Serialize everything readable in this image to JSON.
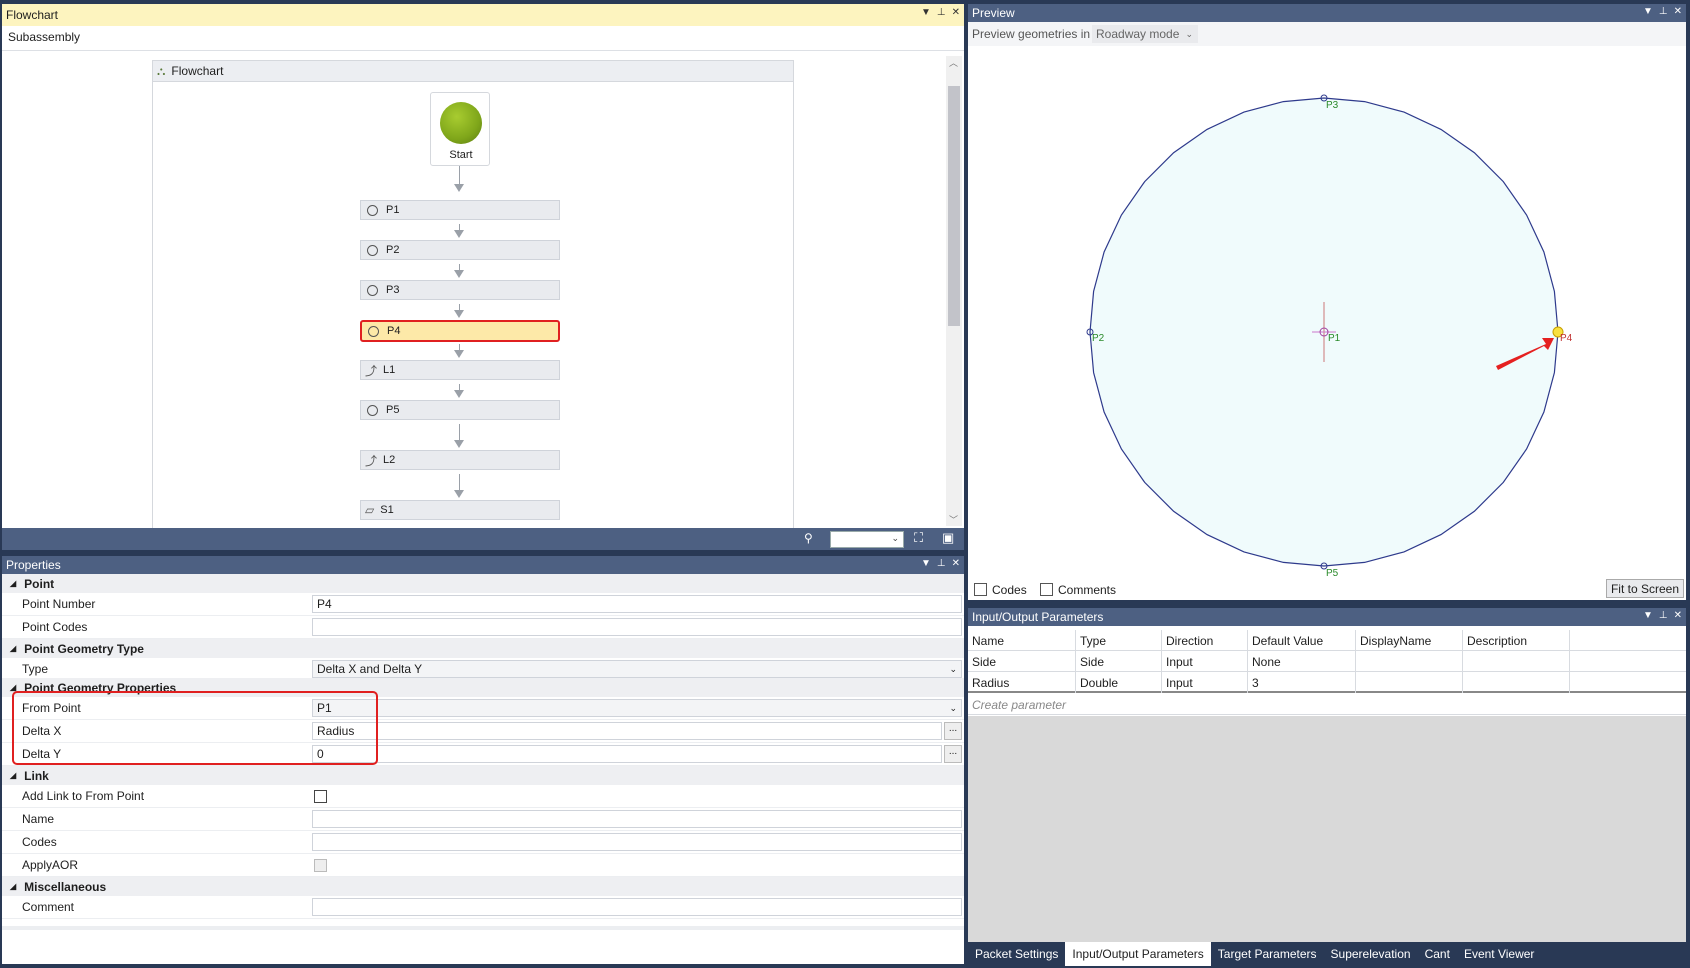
{
  "flowchart": {
    "title": "Flowchart",
    "toolbar_label": "Subassembly",
    "canvas_title": "Flowchart",
    "start_label": "Start",
    "nodes": [
      {
        "label": "P1",
        "icon": "point-icon"
      },
      {
        "label": "P2",
        "icon": "point-icon"
      },
      {
        "label": "P3",
        "icon": "point-icon"
      },
      {
        "label": "P4",
        "icon": "point-icon"
      },
      {
        "label": "L1",
        "icon": "link-icon"
      },
      {
        "label": "P5",
        "icon": "point-icon"
      },
      {
        "label": "L2",
        "icon": "link-icon"
      },
      {
        "label": "S1",
        "icon": "shape-icon"
      }
    ],
    "selected_node": "P4"
  },
  "properties": {
    "title": "Properties",
    "categories": {
      "point": "Point",
      "geometry_type": "Point Geometry Type",
      "geometry_props": "Point Geometry Properties",
      "link": "Link",
      "misc": "Miscellaneous"
    },
    "rows": {
      "point_number_label": "Point Number",
      "point_number_value": "P4",
      "point_codes_label": "Point Codes",
      "point_codes_value": "",
      "type_label": "Type",
      "type_value": "Delta X and Delta Y",
      "from_point_label": "From Point",
      "from_point_value": "P1",
      "delta_x_label": "Delta X",
      "delta_x_value": "Radius",
      "delta_y_label": "Delta Y",
      "delta_y_value": "0",
      "add_link_label": "Add Link to From Point",
      "name_label": "Name",
      "codes_label": "Codes",
      "applyaor_label": "ApplyAOR",
      "comment_label": "Comment"
    },
    "ellipsis": "..."
  },
  "preview": {
    "title": "Preview",
    "geometries_label": "Preview geometries in",
    "mode_value": "Roadway mode",
    "points": {
      "p1": "P1",
      "p2": "P2",
      "p3": "P3",
      "p4": "P4",
      "p5": "P5"
    },
    "codes_label": "Codes",
    "comments_label": "Comments",
    "fit_button": "Fit to Screen"
  },
  "io": {
    "title": "Input/Output Parameters",
    "columns": [
      "Name",
      "Type",
      "Direction",
      "Default Value",
      "DisplayName",
      "Description"
    ],
    "rows": [
      [
        "Side",
        "Side",
        "Input",
        "None",
        "",
        ""
      ],
      [
        "Radius",
        "Double",
        "Input",
        "3",
        "",
        ""
      ]
    ],
    "create_placeholder": "Create parameter"
  },
  "tabs": [
    "Packet Settings",
    "Input/Output Parameters",
    "Target Parameters",
    "Superelevation",
    "Cant",
    "Event Viewer"
  ],
  "colors": {
    "accent_active": "#fdf4bf",
    "title_inactive": "#4d6082",
    "frame": "#293955",
    "highlight_border": "#e02020",
    "circle_fill": "#f0fbfc",
    "circle_stroke": "#2e3a8c",
    "start_green": "#7fa61a"
  }
}
